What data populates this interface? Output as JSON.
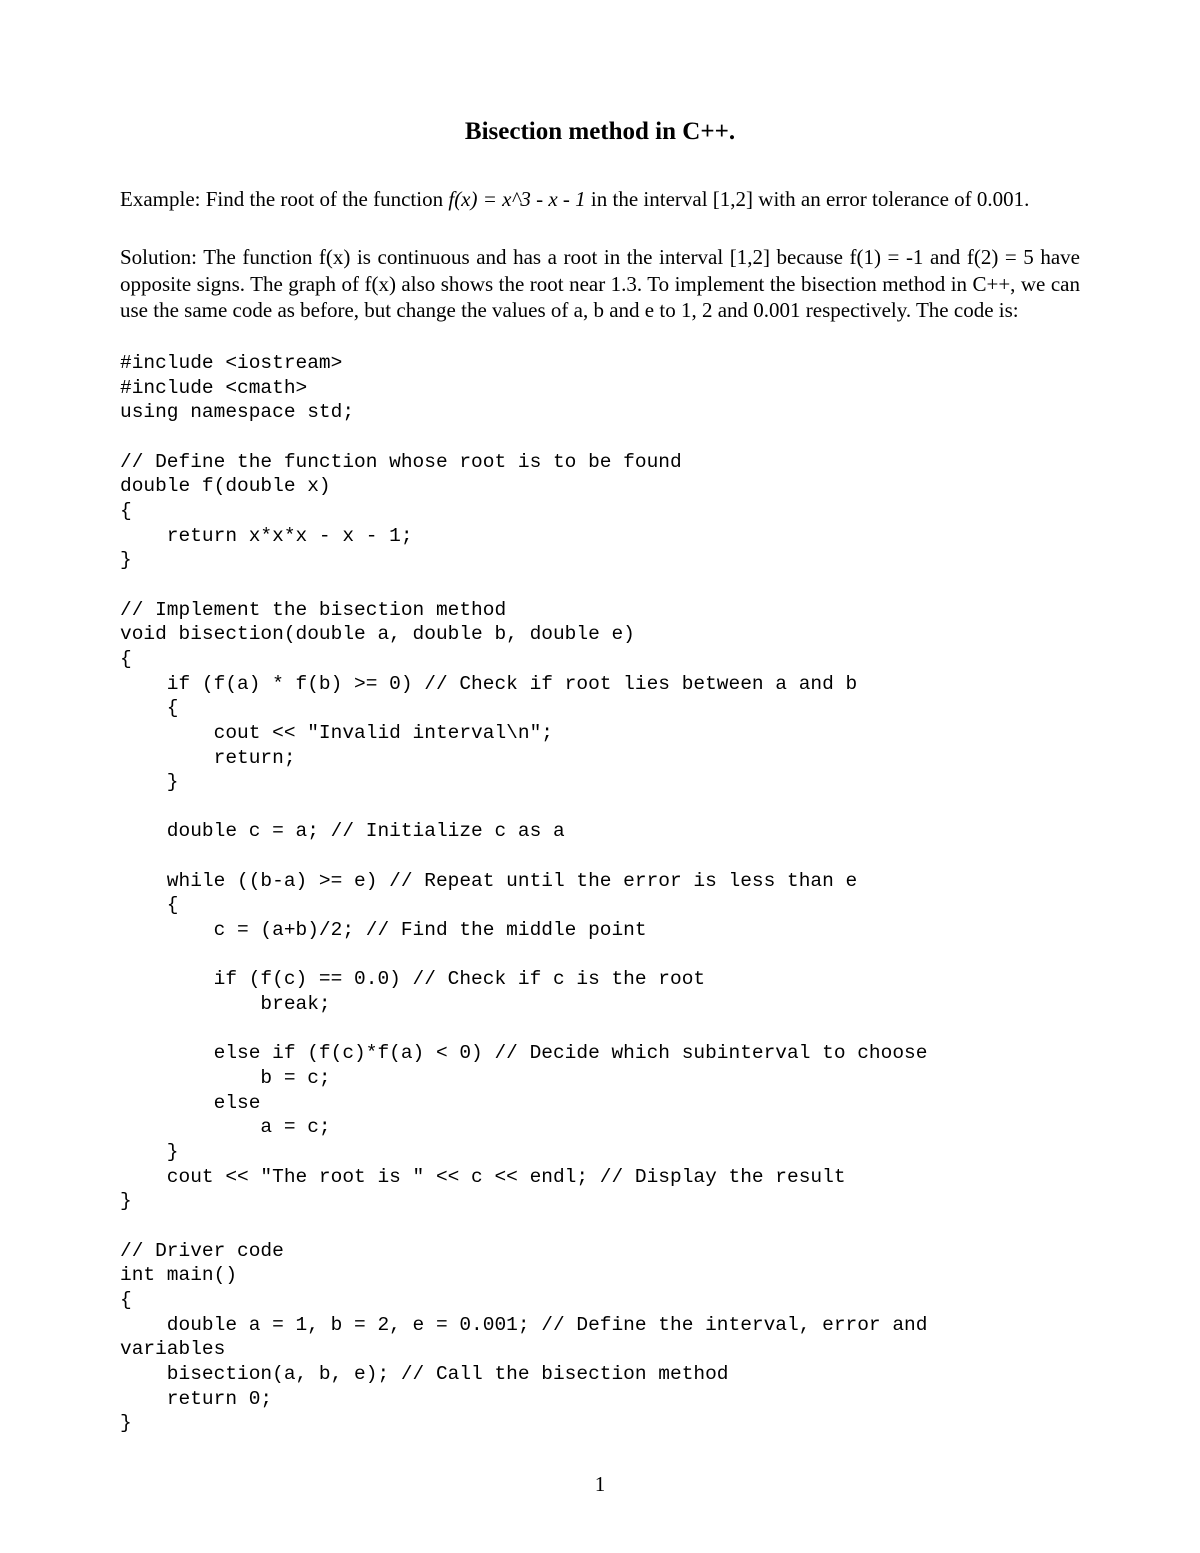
{
  "title": "Bisection method in C++.",
  "example_prefix": "Example: Find the root of the function ",
  "example_function": "f(x) = x^3 - x - 1",
  "example_suffix": " in the interval [1,2] with an error tolerance of 0.001.",
  "solution_text": "Solution: The function f(x) is continuous and has a root in the interval [1,2] because f(1) = -1 and f(2) = 5 have opposite signs. The graph of f(x) also shows the root near 1.3. To implement the bisection method in C++, we can use the same code as before, but change the values of a, b and e to 1, 2 and 0.001 respectively. The code is:",
  "code": "#include <iostream>\n#include <cmath>\nusing namespace std;\n\n// Define the function whose root is to be found\ndouble f(double x)\n{\n    return x*x*x - x - 1;\n}\n\n// Implement the bisection method\nvoid bisection(double a, double b, double e)\n{\n    if (f(a) * f(b) >= 0) // Check if root lies between a and b\n    {\n        cout << \"Invalid interval\\n\";\n        return;\n    }\n\n    double c = a; // Initialize c as a\n\n    while ((b-a) >= e) // Repeat until the error is less than e\n    {\n        c = (a+b)/2; // Find the middle point\n\n        if (f(c) == 0.0) // Check if c is the root\n            break;\n\n        else if (f(c)*f(a) < 0) // Decide which subinterval to choose\n            b = c;\n        else\n            a = c;\n    }\n    cout << \"The root is \" << c << endl; // Display the result\n}\n\n// Driver code\nint main()\n{\n    double a = 1, b = 2, e = 0.001; // Define the interval, error and\nvariables\n    bisection(a, b, e); // Call the bisection method\n    return 0;\n}",
  "page_number": "1"
}
